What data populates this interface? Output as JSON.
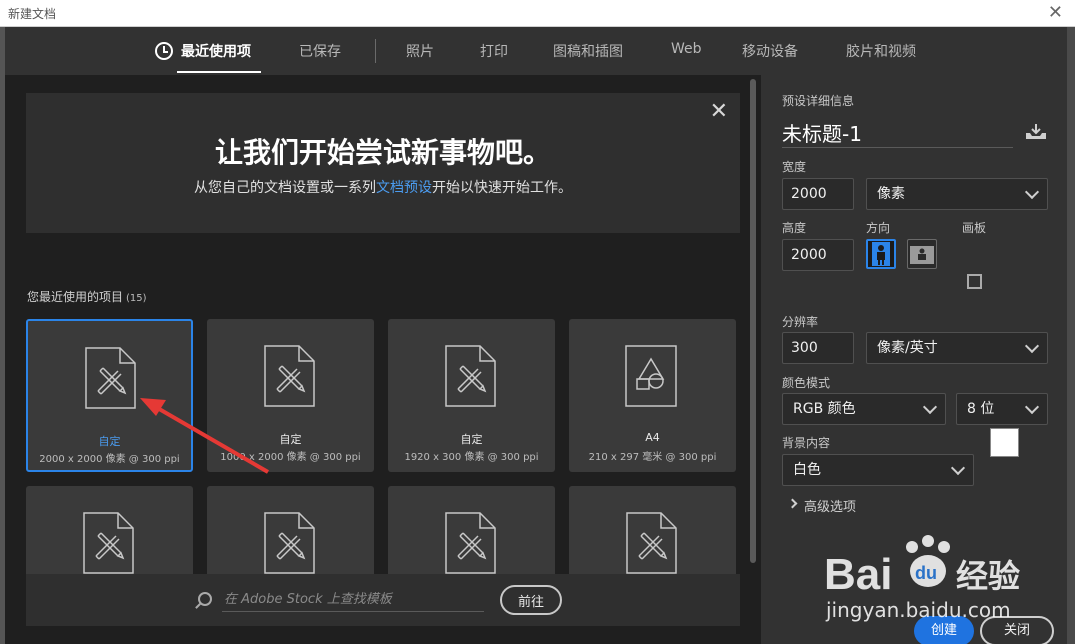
{
  "window": {
    "title": "新建文档",
    "close_glyph": "✕"
  },
  "nav": {
    "tabs": [
      {
        "label": "最近使用项",
        "active": true
      },
      {
        "label": "已保存"
      },
      {
        "label": "照片"
      },
      {
        "label": "打印"
      },
      {
        "label": "图稿和插图"
      },
      {
        "label": "Web"
      },
      {
        "label": "移动设备"
      },
      {
        "label": "胶片和视频"
      }
    ]
  },
  "hero": {
    "title": "让我们开始尝试新事物吧。",
    "subtitle_before": "从您自己的文档设置或一系列",
    "subtitle_link": "文档预设",
    "subtitle_after": "开始以快速开始工作。",
    "close_glyph": "✕"
  },
  "recent": {
    "label": "您最近使用的项目",
    "count": "(15)",
    "items": [
      {
        "name": "自定",
        "size": "2000 x 2000 像素 @ 300 ppi",
        "icon": "document-pencil-ruler-icon",
        "selected": true
      },
      {
        "name": "自定",
        "size": "1000 x 2000 像素 @ 300 ppi",
        "icon": "document-pencil-ruler-icon"
      },
      {
        "name": "自定",
        "size": "1920 x 300 像素 @ 300 ppi",
        "icon": "document-pencil-ruler-icon"
      },
      {
        "name": "A4",
        "size": "210 x 297 毫米 @ 300 ppi",
        "icon": "document-shapes-icon"
      },
      {
        "name": "",
        "size": "",
        "icon": "document-pencil-ruler-icon"
      },
      {
        "name": "",
        "size": "",
        "icon": "document-pencil-ruler-icon"
      },
      {
        "name": "",
        "size": "",
        "icon": "document-pencil-ruler-icon"
      },
      {
        "name": "",
        "size": "",
        "icon": "document-pencil-ruler-icon"
      }
    ]
  },
  "search": {
    "placeholder": "在 Adobe Stock 上查找模板",
    "go_label": "前往"
  },
  "preset": {
    "section_label": "预设详细信息",
    "doc_title": "未标题-1",
    "width_label": "宽度",
    "width_value": "2000",
    "width_unit": "像素",
    "height_label": "高度",
    "height_value": "2000",
    "orientation_label": "方向",
    "artboard_label": "画板",
    "resolution_label": "分辨率",
    "resolution_value": "300",
    "resolution_unit": "像素/英寸",
    "color_mode_label": "颜色模式",
    "color_mode_value": "RGB 颜色",
    "bit_depth_value": "8 位",
    "background_label": "背景内容",
    "background_value": "白色",
    "background_color": "#ffffff",
    "advanced_label": "高级选项"
  },
  "actions": {
    "create_label": "创建",
    "close_label": "关闭"
  },
  "watermark": {
    "brand_a": "Bai",
    "brand_b": "du",
    "brand_cn": "经验",
    "url": "jingyan.baidu.com"
  },
  "colors": {
    "accent": "#2b84e8",
    "link": "#4b9cf0",
    "annotation_arrow": "#e53935"
  }
}
